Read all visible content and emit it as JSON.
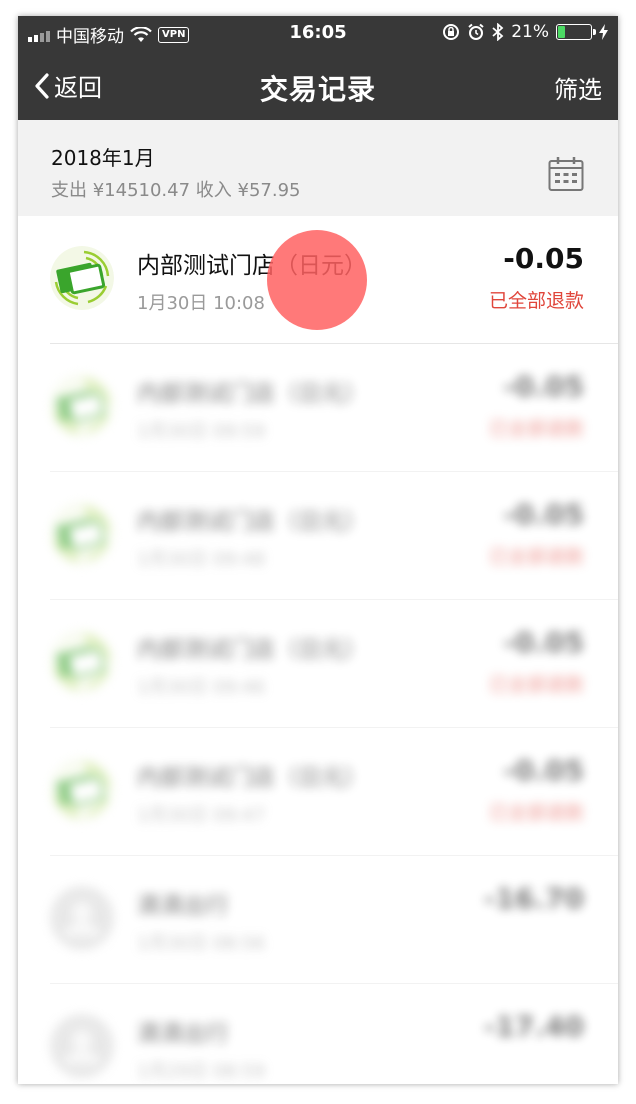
{
  "status_bar": {
    "carrier": "中国移动",
    "vpn": "VPN",
    "time": "16:05",
    "battery": "21%",
    "battery_level": 0.21
  },
  "nav": {
    "back_label": "返回",
    "title": "交易记录",
    "filter_label": "筛选"
  },
  "month_header": {
    "month": "2018年1月",
    "summary": "支出 ¥14510.47 收入 ¥57.95"
  },
  "transactions": [
    {
      "name": "内部测试门店（日元）",
      "date": "1月30日 10:08",
      "amount": "-0.05",
      "status": "已全部退款",
      "icon": "merchant-card-icon"
    },
    {
      "name": "内部测试门店（日元）",
      "date": "1月30日 09:59",
      "amount": "-0.05",
      "status": "已全部退款",
      "icon": "merchant-card-icon"
    },
    {
      "name": "内部测试门店（日元）",
      "date": "1月30日 09:48",
      "amount": "-0.05",
      "status": "已全部退款",
      "icon": "merchant-card-icon"
    },
    {
      "name": "内部测试门店（日元）",
      "date": "1月30日 09:46",
      "amount": "-0.05",
      "status": "已全部退款",
      "icon": "merchant-card-icon"
    },
    {
      "name": "内部测试门店（日元）",
      "date": "1月30日 09:47",
      "amount": "-0.05",
      "status": "已全部退款",
      "icon": "merchant-card-icon"
    },
    {
      "name": "滴滴出行",
      "date": "1月30日 08:56",
      "amount": "-16.70",
      "status": "",
      "icon": "user-avatar-icon"
    },
    {
      "name": "滴滴出行",
      "date": "1月29日 08:59",
      "amount": "-17.40",
      "status": "",
      "icon": "user-avatar-icon"
    }
  ],
  "colors": {
    "topbar": "#383838",
    "refund_status": "#e0463b",
    "battery_fill": "#4cd964",
    "touch_indicator": "#ff6262"
  }
}
